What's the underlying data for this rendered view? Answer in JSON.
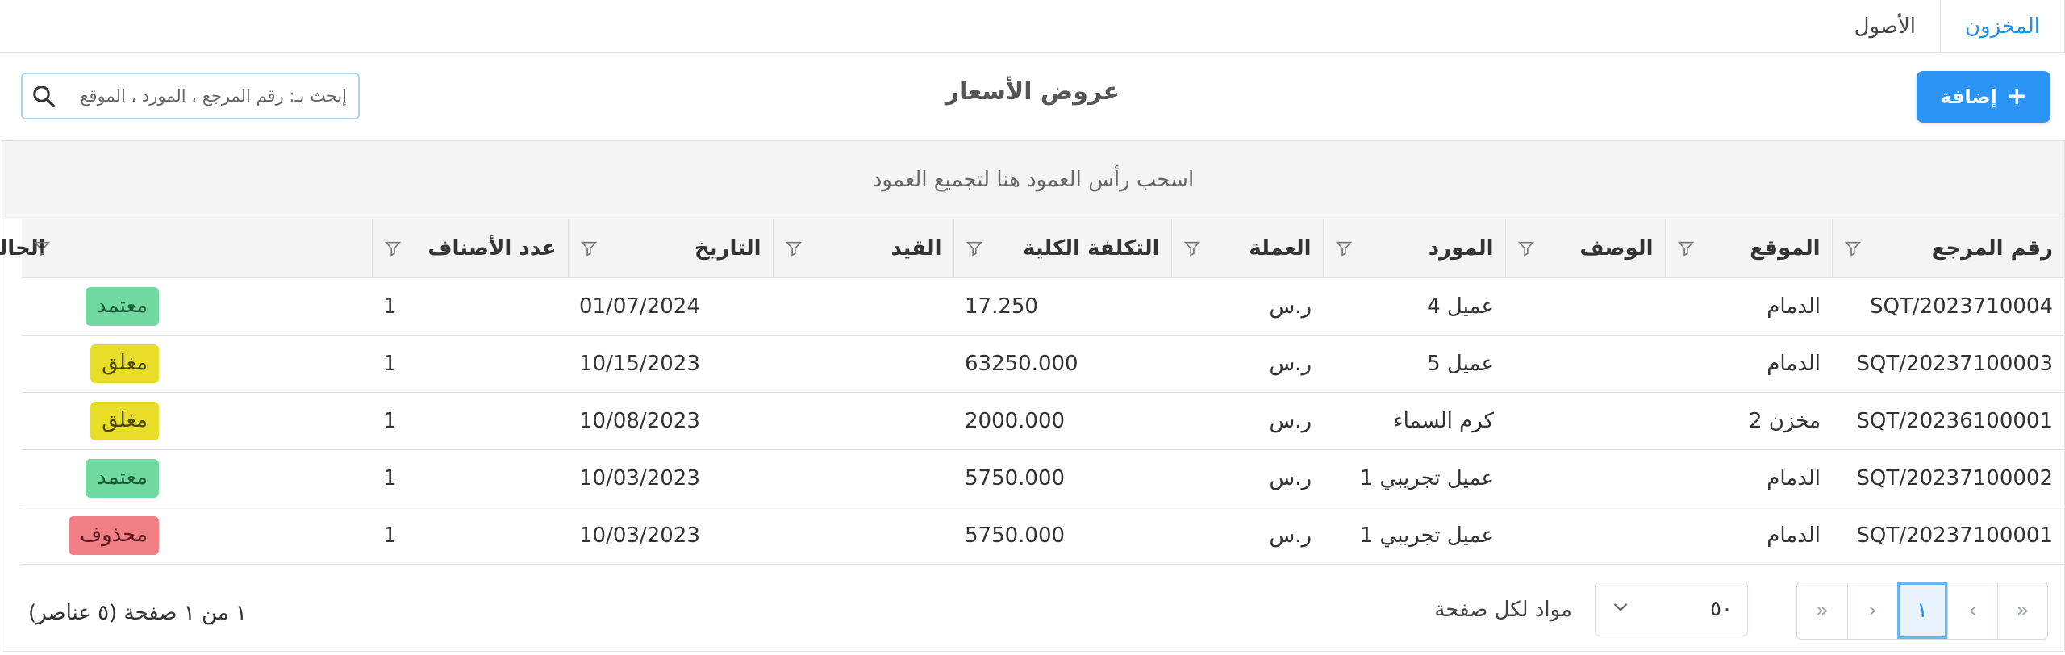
{
  "tabs": [
    {
      "label": "المخزون",
      "active": true
    },
    {
      "label": "الأصول",
      "active": false
    }
  ],
  "toolbar": {
    "add_label": "إضافة",
    "add_icon": "plus-icon",
    "title": "عروض الأسعار",
    "search_placeholder": "إبحث بـ: رقم المرجع ، المورد ، الموقع",
    "search_icon": "search-icon"
  },
  "grid": {
    "group_hint": "اسحب رأس العمود هنا لتجميع العمود",
    "columns": [
      "رقم المرجع",
      "الموقع",
      "الوصف",
      "المورد",
      "العملة",
      "التكلفة الكلية",
      "القيد",
      "التاريخ",
      "عدد الأصناف",
      "الحالة"
    ],
    "rows": [
      {
        "ref": "SQT/2023710004",
        "location": "الدمام",
        "description": "",
        "supplier": "عميل 4",
        "currency": "ر.س",
        "total": "17.250",
        "entry": "",
        "date": "01/07/2024",
        "items": "1",
        "status": "معتمد",
        "status_type": "approved"
      },
      {
        "ref": "SQT/20237100003",
        "location": "الدمام",
        "description": "",
        "supplier": "عميل 5",
        "currency": "ر.س",
        "total": "63250.000",
        "entry": "",
        "date": "10/15/2023",
        "items": "1",
        "status": "مغلق",
        "status_type": "closed"
      },
      {
        "ref": "SQT/20236100001",
        "location": "مخزن 2",
        "description": "",
        "supplier": "كرم السماء",
        "currency": "ر.س",
        "total": "2000.000",
        "entry": "",
        "date": "10/08/2023",
        "items": "1",
        "status": "مغلق",
        "status_type": "closed"
      },
      {
        "ref": "SQT/20237100002",
        "location": "الدمام",
        "description": "",
        "supplier": "عميل تجريبي 1",
        "currency": "ر.س",
        "total": "5750.000",
        "entry": "",
        "date": "10/03/2023",
        "items": "1",
        "status": "معتمد",
        "status_type": "approved"
      },
      {
        "ref": "SQT/20237100001",
        "location": "الدمام",
        "description": "",
        "supplier": "عميل تجريبي 1",
        "currency": "ر.س",
        "total": "5750.000",
        "entry": "",
        "date": "10/03/2023",
        "items": "1",
        "status": "محذوف",
        "status_type": "deleted"
      }
    ]
  },
  "pager": {
    "first": "«",
    "prev": "‹",
    "current_page": "١",
    "next": "›",
    "last": "«",
    "page_size": "٥٠",
    "page_size_label": "مواد لكل صفحة",
    "info": "١ من ١ صفحة (٥ عناصر)"
  },
  "colors": {
    "accent": "#2b95f5",
    "approved": "#6fd9a0",
    "closed": "#e8de2a",
    "deleted": "#f37f86"
  }
}
